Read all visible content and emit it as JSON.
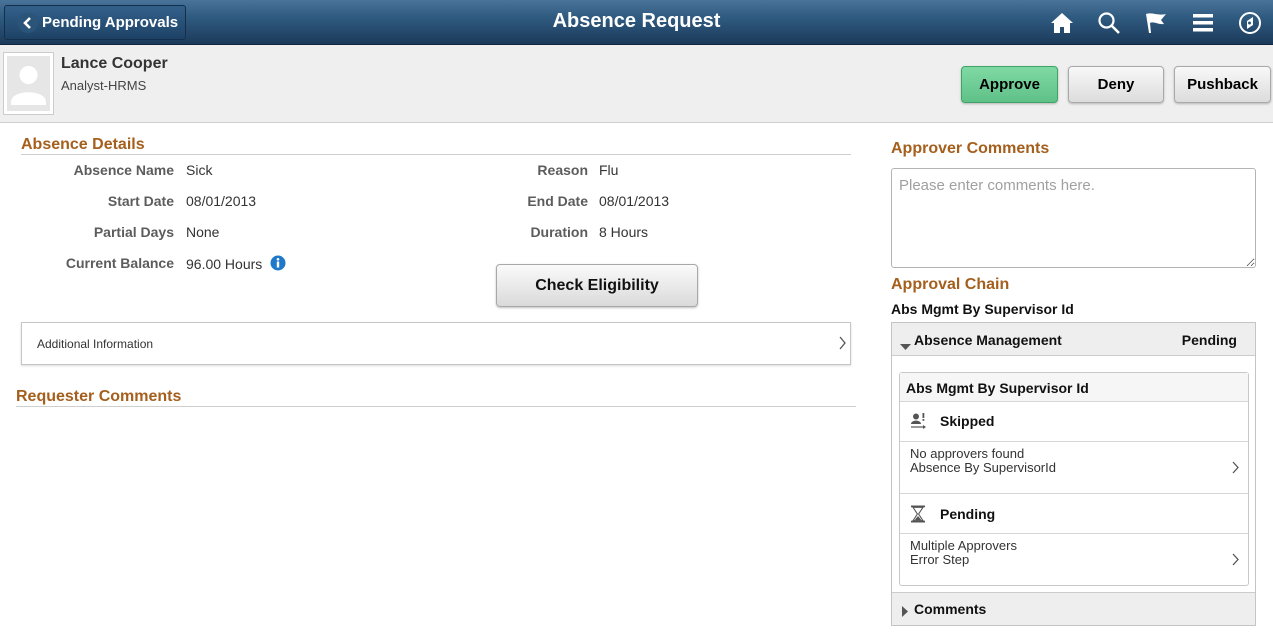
{
  "banner": {
    "back_label": "Pending Approvals",
    "title": "Absence Request",
    "icons": [
      "home-icon",
      "search-icon",
      "flag-icon",
      "menu-icon",
      "navbar-compass-icon"
    ]
  },
  "header": {
    "name": "Lance Cooper",
    "job_title": "Analyst-HRMS",
    "approve_label": "Approve",
    "deny_label": "Deny",
    "pushback_label": "Pushback"
  },
  "absence_details": {
    "title": "Absence Details",
    "left_fields": [
      {
        "label": "Absence Name",
        "value": "Sick"
      },
      {
        "label": "Start Date",
        "value": "08/01/2013"
      },
      {
        "label": "Partial Days",
        "value": "None"
      },
      {
        "label": "Current Balance",
        "value": "96.00 Hours"
      }
    ],
    "right_fields": [
      {
        "label": "Reason",
        "value": "Flu"
      },
      {
        "label": "End Date",
        "value": "08/01/2013"
      },
      {
        "label": "Duration",
        "value": "8 Hours"
      }
    ],
    "check_eligibility_label": "Check Eligibility",
    "additional_info_label": "Additional Information"
  },
  "requester_comments": {
    "title": "Requester Comments"
  },
  "approver_comments": {
    "title": "Approver Comments",
    "placeholder": "Please enter comments here.",
    "value": ""
  },
  "approval_chain": {
    "title": "Approval Chain",
    "process_name": "Abs Mgmt By Supervisor Id",
    "group_title": "Absence Management",
    "group_status": "Pending",
    "card_title": "Abs Mgmt By Supervisor Id",
    "steps": [
      {
        "status": "Skipped",
        "icon": "skipped-user-icon",
        "line1": "No approvers found",
        "line2": "Absence By SupervisorId"
      },
      {
        "status": "Pending",
        "icon": "hourglass-icon",
        "line1": "Multiple Approvers",
        "line2": "Error Step"
      }
    ],
    "comments_label": "Comments"
  },
  "colors": {
    "section_title": "#a55f1d",
    "approve_button": "#6fcd95",
    "banner": "#2f5a80"
  }
}
